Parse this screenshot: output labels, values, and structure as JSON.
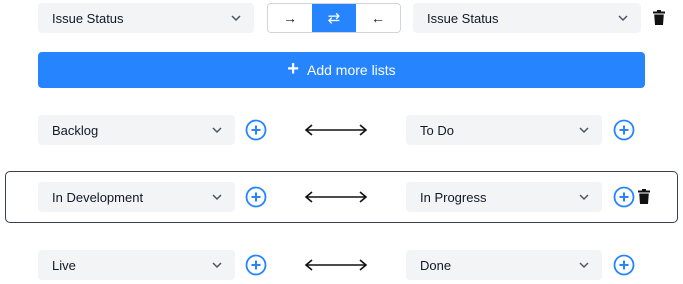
{
  "header": {
    "left_select": "Issue Status",
    "right_select": "Issue Status",
    "direction_buttons": [
      {
        "label": "→",
        "active": false
      },
      {
        "label": "⇄",
        "active": true
      },
      {
        "label": "←",
        "active": false
      }
    ]
  },
  "add_lists_button": {
    "label": "Add more lists",
    "icon": "+"
  },
  "mappings": [
    {
      "left": "Backlog",
      "right": "To Do"
    },
    {
      "left": "In Development",
      "right": "In Progress"
    },
    {
      "left": "Live",
      "right": "Done"
    }
  ],
  "colors": {
    "accent": "#2684ff",
    "field_bg": "#f3f4f6"
  }
}
